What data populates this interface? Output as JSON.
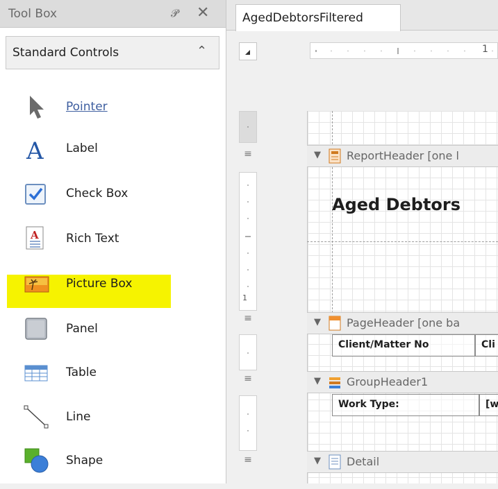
{
  "toolbox": {
    "title": "Tool Box",
    "pin_icon": "pin-icon",
    "close_icon": "close-icon",
    "category": {
      "label": "Standard Controls",
      "icon": "chevron-up-icon"
    },
    "items": [
      {
        "label": "Pointer",
        "icon": "pointer-icon"
      },
      {
        "label": "Label",
        "icon": "label-icon"
      },
      {
        "label": "Check Box",
        "icon": "checkbox-icon"
      },
      {
        "label": "Rich Text",
        "icon": "rich-text-icon"
      },
      {
        "label": "Picture Box",
        "icon": "picture-box-icon"
      },
      {
        "label": "Panel",
        "icon": "panel-icon"
      },
      {
        "label": "Table",
        "icon": "table-icon"
      },
      {
        "label": "Line",
        "icon": "line-icon"
      },
      {
        "label": "Shape",
        "icon": "shape-icon"
      }
    ],
    "highlight_color": "#f6f300"
  },
  "document_tab": {
    "label": "AgedDebtorsFiltered"
  },
  "ruler": {
    "top_number": "1",
    "left_number": "1"
  },
  "designer": {
    "bands": [
      {
        "label": "ReportHeader [one l",
        "icon": "report-header-icon"
      },
      {
        "label": "PageHeader [one ba",
        "icon": "page-header-icon"
      },
      {
        "label": "GroupHeader1",
        "icon": "group-header-icon"
      },
      {
        "label": "Detail",
        "icon": "detail-icon"
      }
    ],
    "report_title": "Aged Debtors",
    "page_header_cells": [
      "Client/Matter No",
      "Cli"
    ],
    "group_header_cells": [
      "Work Type:",
      "[w"
    ]
  }
}
